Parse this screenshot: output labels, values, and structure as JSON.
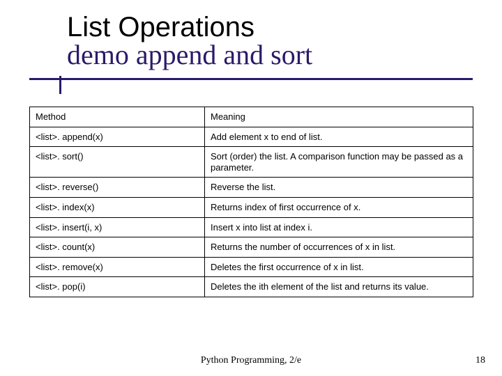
{
  "title": {
    "line1": "List Operations",
    "line2": "demo append and sort"
  },
  "table": {
    "header": {
      "col1": "Method",
      "col2": "Meaning"
    },
    "rows": [
      {
        "method": "<list>. append(x)",
        "meaning": "Add element x to end of list."
      },
      {
        "method": "<list>. sort()",
        "meaning": "Sort (order) the list. A comparison function may be passed as a parameter."
      },
      {
        "method": "<list>. reverse()",
        "meaning": "Reverse the list."
      },
      {
        "method": "<list>. index(x)",
        "meaning": "Returns index of first occurrence of x."
      },
      {
        "method": "<list>. insert(i, x)",
        "meaning": "Insert x into list at index i."
      },
      {
        "method": "<list>. count(x)",
        "meaning": "Returns the number of occurrences of x in list."
      },
      {
        "method": "<list>. remove(x)",
        "meaning": "Deletes the first occurrence of x in list."
      },
      {
        "method": "<list>. pop(i)",
        "meaning": "Deletes the ith element of the list and returns its value."
      }
    ]
  },
  "footer": "Python Programming, 2/e",
  "page_number": "18",
  "chart_data": {
    "type": "table",
    "columns": [
      "Method",
      "Meaning"
    ],
    "rows": [
      [
        "<list>. append(x)",
        "Add element x to end of list."
      ],
      [
        "<list>. sort()",
        "Sort (order) the list. A comparison function may be passed as a parameter."
      ],
      [
        "<list>. reverse()",
        "Reverse the list."
      ],
      [
        "<list>. index(x)",
        "Returns index of first occurrence of x."
      ],
      [
        "<list>. insert(i, x)",
        "Insert x into list at index i."
      ],
      [
        "<list>. count(x)",
        "Returns the number of occurrences of x in list."
      ],
      [
        "<list>. remove(x)",
        "Deletes the first occurrence of x in list."
      ],
      [
        "<list>. pop(i)",
        "Deletes the ith element of the list and returns its value."
      ]
    ]
  }
}
